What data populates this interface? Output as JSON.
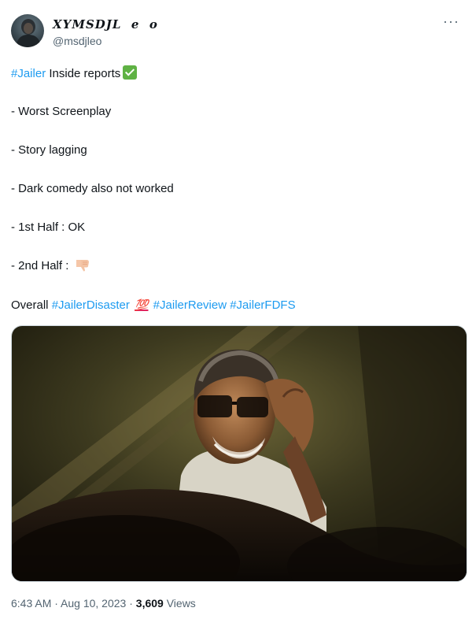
{
  "author": {
    "display_name": "𝑿𝒀𝑴𝑺𝑫𝑱L  e  o",
    "handle": "@msdjleo",
    "avatar_icon": "profile-photo"
  },
  "more_icon": "···",
  "tweet": {
    "line1_hashtag": "#Jailer",
    "line1_text": " Inside reports",
    "line1_emoji": "check-mark-emoji",
    "item1": "- Worst Screenplay",
    "item2": "- Story lagging",
    "item3": "- Dark comedy also not worked",
    "item4": "- 1st Half : OK",
    "item5": "- 2nd Half : ",
    "item5_emoji": "thumbs-down-emoji",
    "overall_text": "Overall ",
    "overall_hashtag1": "#JailerDisaster",
    "hundred_emoji": "💯",
    "overall_hashtag2": "#JailerReview",
    "overall_hashtag3": "#JailerFDFS"
  },
  "media": {
    "description": "photo"
  },
  "meta": {
    "timestamp": "6:43 AM · Aug 10, 2023 · ",
    "views_count": "3,609",
    "views_label": " Views"
  }
}
